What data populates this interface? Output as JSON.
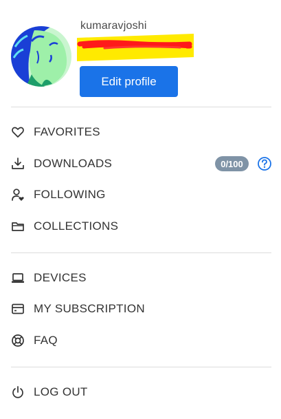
{
  "profile": {
    "username": "kumaravjoshi",
    "edit_label": "Edit profile"
  },
  "menu": {
    "favorites": {
      "label": "FAVORITES",
      "icon": "heart-icon"
    },
    "downloads": {
      "label": "DOWNLOADS",
      "icon": "download-icon",
      "badge": "0/100",
      "help_icon": "question-circle-icon"
    },
    "following": {
      "label": "FOLLOWING",
      "icon": "user-heart-icon"
    },
    "collections": {
      "label": "COLLECTIONS",
      "icon": "folder-icon"
    },
    "devices": {
      "label": "DEVICES",
      "icon": "laptop-icon"
    },
    "subscription": {
      "label": "MY SUBSCRIPTION",
      "icon": "credit-card-icon"
    },
    "faq": {
      "label": "FAQ",
      "icon": "lifebuoy-icon"
    },
    "logout": {
      "label": "LOG OUT",
      "icon": "power-icon"
    }
  },
  "colors": {
    "accent": "#1a73e8",
    "badge": "#7f93a6",
    "highlight": "#ffea00",
    "redaction": "#ff1a1a",
    "text": "#333333"
  }
}
